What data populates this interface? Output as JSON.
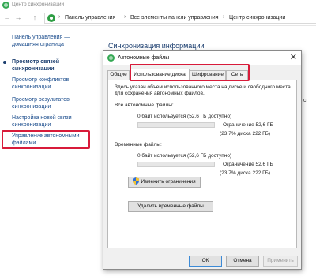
{
  "window": {
    "title": "Центр синхронизации"
  },
  "nav": {
    "back": "←",
    "forward": "→",
    "up": "↑"
  },
  "breadcrumb": {
    "items": [
      "Панель управления",
      "Все элементы панели управления",
      "Центр синхронизации"
    ],
    "sep": "›"
  },
  "sidebar": {
    "items": [
      {
        "label": "Панель управления — домашняя страница"
      },
      {
        "label": "Просмотр связей синхронизации"
      },
      {
        "label": "Просмотр конфликтов синхронизации"
      },
      {
        "label": "Просмотр результатов синхронизации"
      },
      {
        "label": "Настройка новой связи синхронизации"
      },
      {
        "label": "Управление автономными файлами"
      }
    ]
  },
  "main": {
    "heading": "Синхронизация информации",
    "behind_text": "с"
  },
  "dialog": {
    "title": "Автономные файлы",
    "close": "✕",
    "tabs": [
      "Общие",
      "Использование диска",
      "Шифрование",
      "Сеть"
    ],
    "active_tab": 1,
    "description": "Здесь указан объем использованного места на диске и свободного места для сохранения автономных файлов.",
    "all_files": {
      "label": "Все автономные файлы:",
      "used": "0 байт используется (52,6 ГБ доступно)",
      "fill": 0,
      "limit": "Ограничение 52,6 ГБ",
      "percent": "(23,7% диска 222 ГБ)"
    },
    "temp_files": {
      "label": "Временные файлы:",
      "used": "0 байт используется (52,6 ГБ доступно)",
      "fill": 0,
      "limit": "Ограничение 52,6 ГБ",
      "percent": "(23,7% диска 222 ГБ)"
    },
    "buttons": {
      "change_limits": "Изменить ограничения",
      "delete_temp": "Удалить временные файлы",
      "ok": "ОК",
      "cancel": "Отмена",
      "apply": "Применить"
    }
  },
  "colors": {
    "highlight": "#d81b3a",
    "link": "#1a4c8c",
    "bar_fill": "#1e90d6"
  }
}
